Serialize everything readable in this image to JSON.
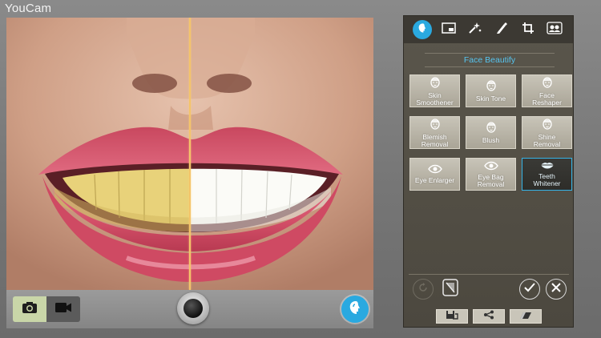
{
  "app": {
    "title": "YouCam"
  },
  "panel": {
    "section_title": "Face Beautify",
    "toolbar_icons": [
      "face-beautify-icon",
      "frame-icon",
      "effects-icon",
      "brush-icon",
      "crop-icon",
      "face-swap-icon"
    ],
    "tools": [
      {
        "name": "skin-smoothener",
        "label_lines": [
          "Skin",
          "Smoothener"
        ],
        "icon": "face-icon",
        "selected": false
      },
      {
        "name": "skin-tone",
        "label_lines": [
          "Skin Tone"
        ],
        "icon": "face-icon",
        "selected": false
      },
      {
        "name": "face-reshaper",
        "label_lines": [
          "Face",
          "Reshaper"
        ],
        "icon": "face-icon",
        "selected": false
      },
      {
        "name": "blemish-removal",
        "label_lines": [
          "Blemish",
          "Removal"
        ],
        "icon": "face-icon",
        "selected": false
      },
      {
        "name": "blush",
        "label_lines": [
          "Blush"
        ],
        "icon": "face-icon",
        "selected": false
      },
      {
        "name": "shine-removal",
        "label_lines": [
          "Shine",
          "Removal"
        ],
        "icon": "face-icon",
        "selected": false
      },
      {
        "name": "eye-enlarger",
        "label_lines": [
          "Eye Enlarger"
        ],
        "icon": "eye-icon",
        "selected": false
      },
      {
        "name": "eye-bag-removal",
        "label_lines": [
          "Eye Bag",
          "Removal"
        ],
        "icon": "eye-icon",
        "selected": false
      },
      {
        "name": "teeth-whitener",
        "label_lines": [
          "Teeth",
          "Whitener"
        ],
        "icon": "lips-icon",
        "selected": true
      }
    ]
  },
  "colors": {
    "accent": "#2aa9e0",
    "title_text": "#56c3ee",
    "split_line": "#f4c46a"
  }
}
